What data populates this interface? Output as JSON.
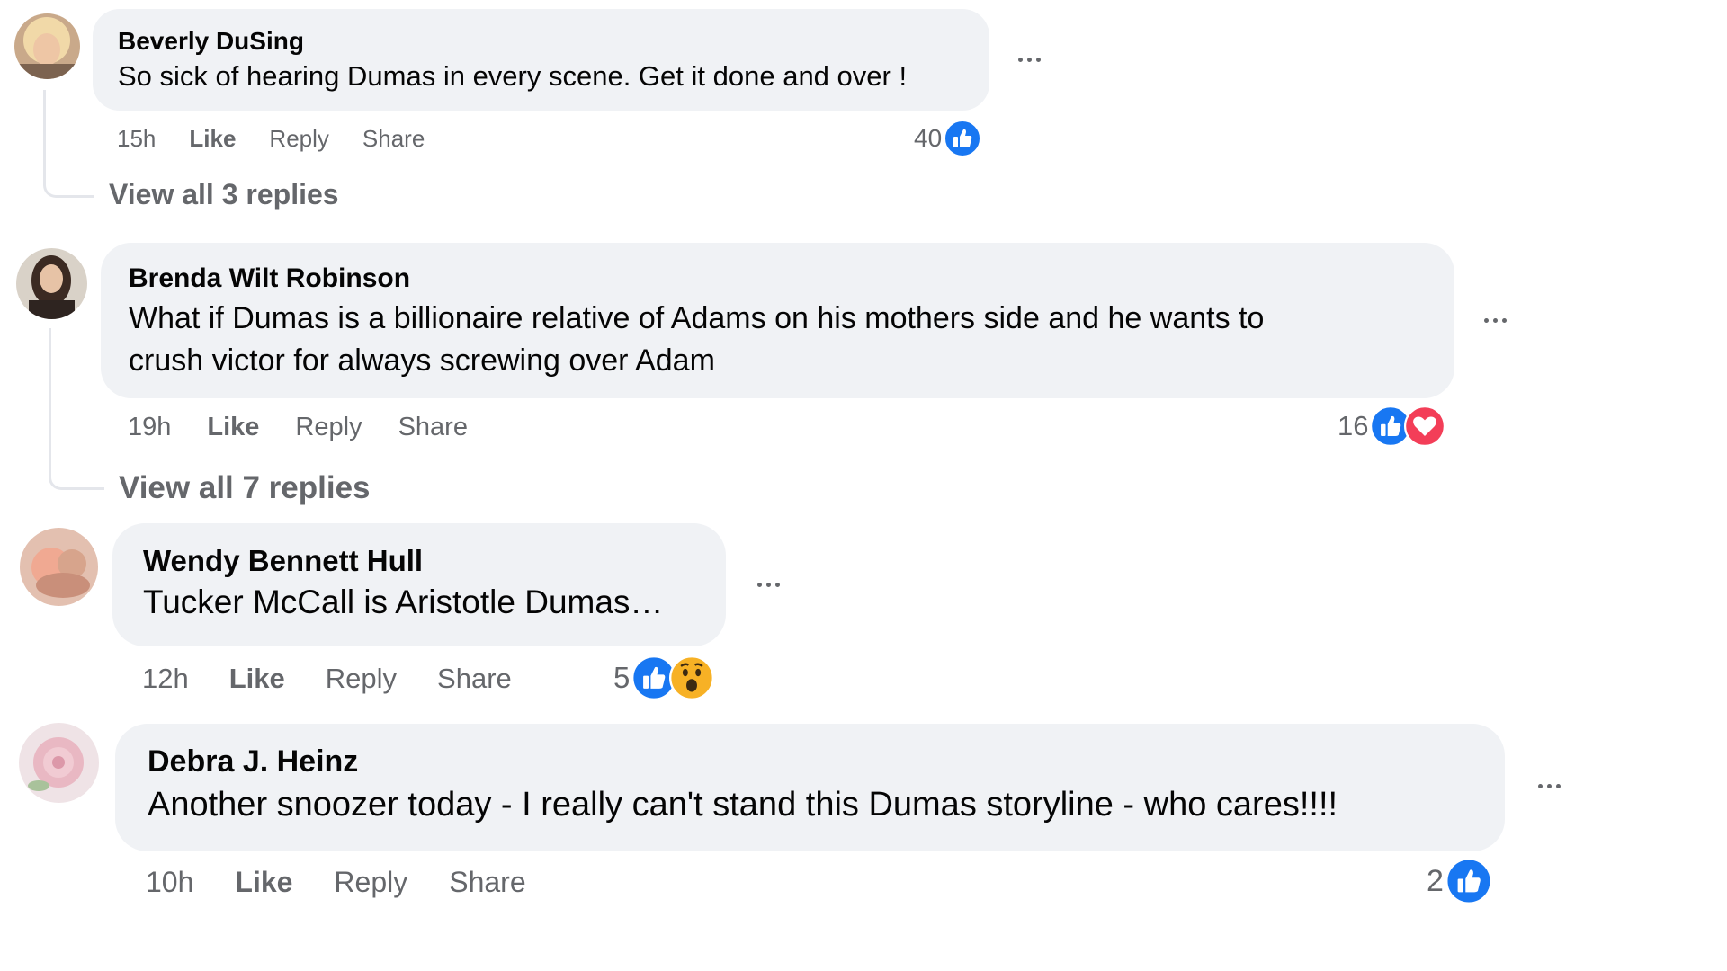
{
  "comments": [
    {
      "author": "Beverly DuSing",
      "text": "So sick of hearing Dumas in every scene. Get it done and over !",
      "time": "15h",
      "like_label": "Like",
      "reply_label": "Reply",
      "share_label": "Share",
      "reaction_count": "40",
      "reactions": [
        "like-reaction-icon"
      ],
      "view_replies": "View all 3 replies"
    },
    {
      "author": "Brenda Wilt Robinson",
      "text_line1": "What if Dumas is a billionaire relative of Adams on his mothers side and he wants to",
      "text_line2": "crush victor for always screwing over Adam",
      "time": "19h",
      "like_label": "Like",
      "reply_label": "Reply",
      "share_label": "Share",
      "reaction_count": "16",
      "reactions": [
        "like-reaction-icon",
        "love-reaction-icon"
      ],
      "view_replies": "View all 7 replies"
    },
    {
      "author": "Wendy Bennett Hull",
      "text": "Tucker McCall is Aristotle Dumas…",
      "time": "12h",
      "like_label": "Like",
      "reply_label": "Reply",
      "share_label": "Share",
      "reaction_count": "5",
      "reactions": [
        "like-reaction-icon",
        "wow-reaction-icon"
      ]
    },
    {
      "author": "Debra J. Heinz",
      "text": "Another snoozer today - I really can't stand this Dumas storyline - who cares!!!!",
      "time": "10h",
      "like_label": "Like",
      "reply_label": "Reply",
      "share_label": "Share",
      "reaction_count": "2",
      "reactions": [
        "like-reaction-icon"
      ]
    }
  ],
  "colors": {
    "bubble": "#f0f2f5",
    "secondary_text": "#65676b",
    "like_blue": "#1877f2",
    "love_red": "#f33e58",
    "wow_yellow": "#f7b125"
  }
}
